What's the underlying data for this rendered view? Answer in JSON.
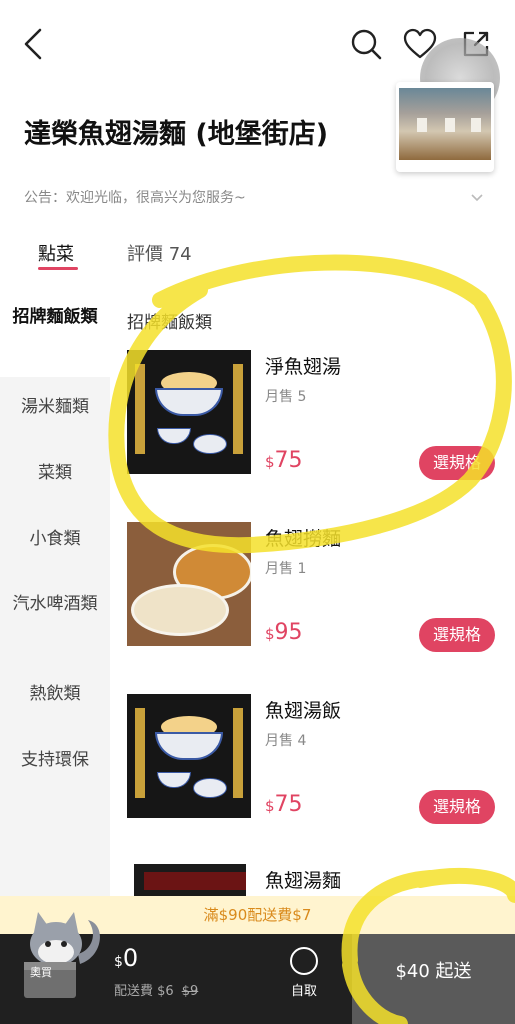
{
  "header": {
    "back_icon": "chevron-left-icon",
    "search_icon": "search-icon",
    "favorite_icon": "heart-icon",
    "share_icon": "share-icon"
  },
  "shop": {
    "name": "達榮魚翅湯麵 (地堡街店)",
    "notice": "公告：欢迎光临，很高兴为您服务~"
  },
  "tabs": [
    {
      "label": "點菜"
    },
    {
      "label": "評價 74"
    }
  ],
  "categories": [
    {
      "label": "招牌麵飯類"
    },
    {
      "label": "湯米麵類"
    },
    {
      "label": "菜類"
    },
    {
      "label": "小食類"
    },
    {
      "label": "汽水啤酒類"
    },
    {
      "label": "熱飲類"
    },
    {
      "label": "支持環保"
    }
  ],
  "section_title": "招牌麵飯類",
  "items": [
    {
      "name": "淨魚翅湯",
      "sold": "月售 5",
      "currency": "$",
      "price": "75",
      "button": "選規格"
    },
    {
      "name": "魚翅撈麵",
      "sold": "月售 1",
      "currency": "$",
      "price": "95",
      "button": "選規格"
    },
    {
      "name": "魚翅湯飯",
      "sold": "月售 4",
      "currency": "$",
      "price": "75",
      "button": "選規格"
    },
    {
      "name": "魚翅湯麵"
    }
  ],
  "promo": "滿$90配送費$7",
  "cart": {
    "mascot_label": "奧買",
    "currency": "$",
    "total": "0",
    "delivery_fee": "配送費 $6",
    "delivery_fee_original": "$9",
    "pickup_label": "自取",
    "checkout": "$40 起送"
  },
  "colors": {
    "accent": "#e04462",
    "promo_text": "#d98a1c",
    "highlight_marker": "#f5e02a"
  }
}
